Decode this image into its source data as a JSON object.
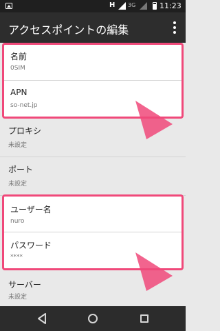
{
  "status_bar": {
    "network_type": "H",
    "mobile_data_label": "3G",
    "time": "11:23",
    "icons": [
      "gallery-notification-icon",
      "wifi-signal-icon",
      "cell-signal-icon",
      "battery-icon"
    ]
  },
  "app_bar": {
    "title": "アクセスポイントの編集",
    "overflow_icon": "more-vert-icon"
  },
  "settings": [
    {
      "label": "名前",
      "value": "0SIM",
      "highlighted": true
    },
    {
      "label": "APN",
      "value": "so-net.jp",
      "highlighted": true
    },
    {
      "label": "プロキシ",
      "value": "未設定",
      "highlighted": false
    },
    {
      "label": "ポート",
      "value": "未設定",
      "highlighted": false
    },
    {
      "label": "ユーザー名",
      "value": "nuro",
      "highlighted": true
    },
    {
      "label": "パスワード",
      "value": "****",
      "highlighted": true
    },
    {
      "label": "サーバー",
      "value": "未設定",
      "highlighted": false
    }
  ],
  "annotation_color": "#f0497a",
  "nav_bar": {
    "icons": [
      "back-icon",
      "home-icon",
      "recent-apps-icon"
    ]
  }
}
